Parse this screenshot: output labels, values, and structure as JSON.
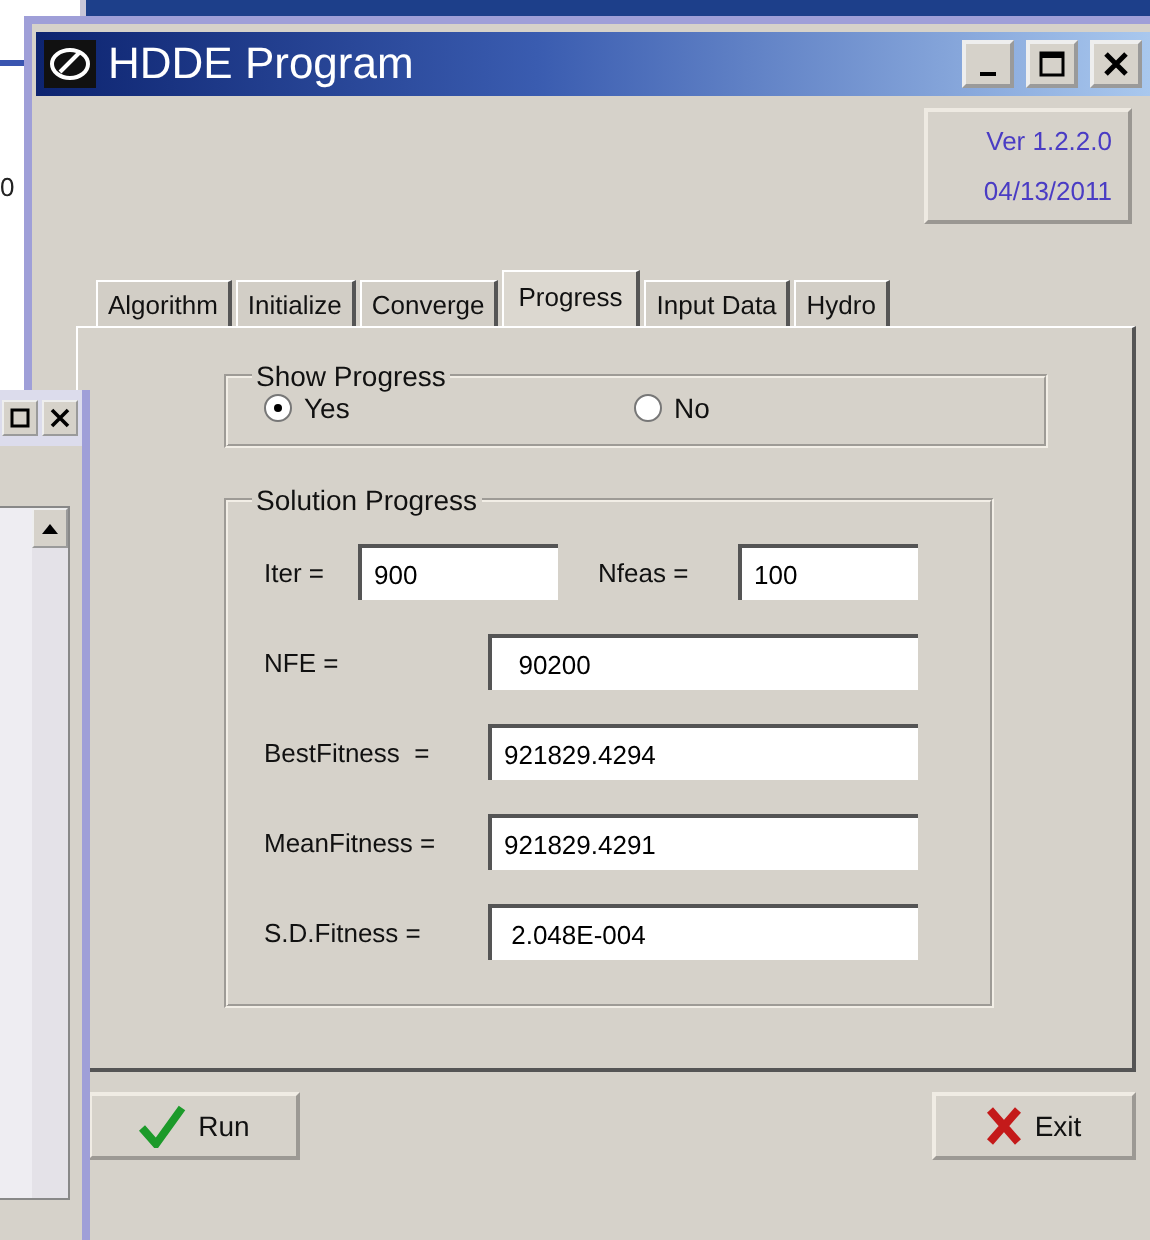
{
  "back_window": {
    "text": "0"
  },
  "window": {
    "title": "HDDE Program"
  },
  "version": {
    "version": "Ver 1.2.2.0",
    "date": "04/13/2011"
  },
  "tabs": [
    {
      "label": "Algorithm",
      "selected": false
    },
    {
      "label": "Initialize",
      "selected": false
    },
    {
      "label": "Converge",
      "selected": false
    },
    {
      "label": "Progress",
      "selected": true
    },
    {
      "label": "Input Data",
      "selected": false
    },
    {
      "label": "Hydro",
      "selected": false
    }
  ],
  "show_progress": {
    "title": "Show Progress",
    "options": [
      {
        "label": "Yes",
        "selected": true
      },
      {
        "label": "No",
        "selected": false
      }
    ]
  },
  "solution_progress": {
    "title": "Solution Progress",
    "rows": [
      {
        "fields": [
          {
            "label": "Iter =",
            "value": "900"
          },
          {
            "label": "Nfeas =",
            "value": "100"
          }
        ]
      },
      {
        "fields": [
          {
            "label": "NFE =",
            "value": "  90200"
          }
        ]
      },
      {
        "fields": [
          {
            "label": "BestFitness  =",
            "value": "921829.4294"
          }
        ]
      },
      {
        "fields": [
          {
            "label": "MeanFitness =",
            "value": "921829.4291"
          }
        ]
      },
      {
        "fields": [
          {
            "label": "S.D.Fitness =",
            "value": " 2.048E-004"
          }
        ]
      }
    ]
  },
  "buttons": [
    {
      "label": "Run",
      "kind": "run"
    },
    {
      "label": "Exit",
      "kind": "exit"
    }
  ]
}
